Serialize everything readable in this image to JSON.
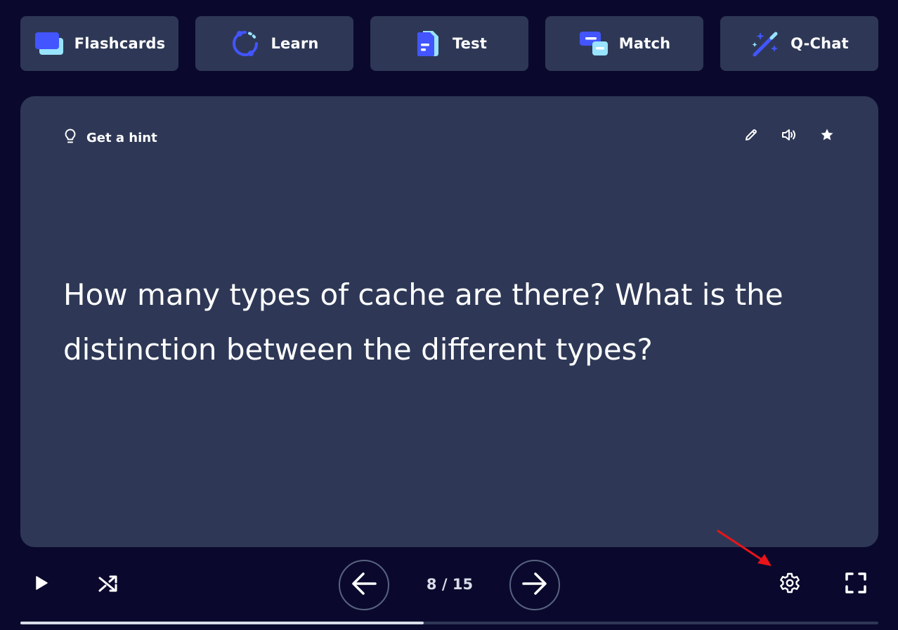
{
  "study_modes": [
    {
      "label": "Flashcards",
      "icon": "flashcards-icon"
    },
    {
      "label": "Learn",
      "icon": "learn-icon"
    },
    {
      "label": "Test",
      "icon": "test-icon"
    },
    {
      "label": "Match",
      "icon": "match-icon"
    },
    {
      "label": "Q-Chat",
      "icon": "magic-wand-icon"
    }
  ],
  "card": {
    "hint_label": "Get a hint",
    "term": "How many types of cache are there? What is the distinction between the different types?",
    "actions": [
      "edit-icon",
      "audio-icon",
      "star-icon"
    ]
  },
  "controls": {
    "counter": "8 / 15",
    "progress_fraction": 0.47
  },
  "colors": {
    "background": "#0a092d",
    "surface": "#2e3856",
    "accent_blue": "#4255ff",
    "accent_cyan": "#98e3ff",
    "annotation_red": "#e8141a"
  }
}
